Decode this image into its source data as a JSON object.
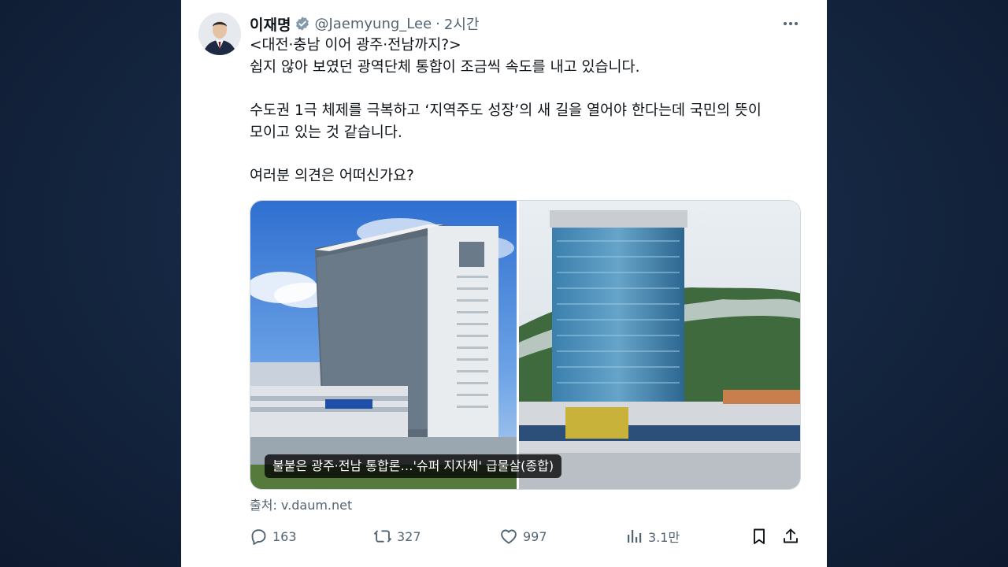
{
  "author": {
    "name": "이재명",
    "handle": "@Jaemyung_Lee",
    "time": "2시간"
  },
  "tweet": {
    "lines": [
      "<대전·충남 이어 광주·전남까지?>",
      "쉽지 않아 보였던 광역단체 통합이 조금씩 속도를 내고 있습니다.",
      "수도권 1극 체제를 극복하고 ‘지역주도 성장’의 새 길을 열어야 한다는데 국민의 뜻이",
      "모이고 있는 것 같습니다.",
      "여러분 의견은 어떠신가요?"
    ]
  },
  "media": {
    "caption": "불붙은 광주·전남 통합론…'슈퍼 지자체' 급물살(종합)"
  },
  "source": "출처: v.daum.net",
  "actions": {
    "reply_count": "163",
    "retweet_count": "327",
    "like_count": "997",
    "view_count": "3.1만"
  },
  "colors": {
    "background": "#142440",
    "text": "#0f1419",
    "muted": "#536471",
    "verified": "#829aab"
  }
}
